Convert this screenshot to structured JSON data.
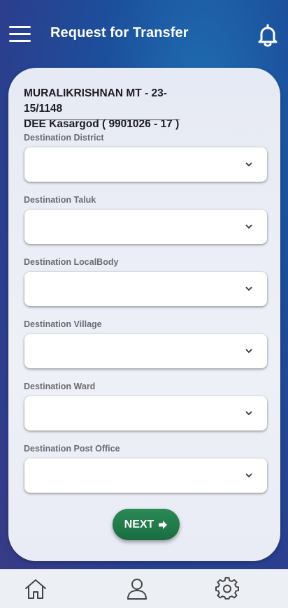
{
  "header": {
    "title": "Request for Transfer",
    "menu_icon": "hamburger-menu-icon",
    "notification_icon": "bell-icon"
  },
  "user": {
    "line1": "MURALIKRISHNAN MT - 23-15/1148",
    "line2": "DEE Kasargod ( 9901026 - 17 )"
  },
  "fields": [
    {
      "label": "Destination District",
      "value": ""
    },
    {
      "label": "Destination Taluk",
      "value": ""
    },
    {
      "label": "Destination LocalBody",
      "value": ""
    },
    {
      "label": "Destination Village",
      "value": ""
    },
    {
      "label": "Destination Ward",
      "value": ""
    },
    {
      "label": "Destination Post Office",
      "value": ""
    }
  ],
  "next_button": {
    "label": "NEXT",
    "icon": "arrow-right-icon"
  },
  "bottom_nav": [
    {
      "name": "home",
      "icon": "home-icon"
    },
    {
      "name": "profile",
      "icon": "person-icon"
    },
    {
      "name": "settings",
      "icon": "gear-icon"
    }
  ],
  "colors": {
    "header_bg": "#1c4f9c",
    "card_bg": "#e9ecf5",
    "next_button": "#1f7a48",
    "bottom_nav_bg": "#eceff3"
  }
}
